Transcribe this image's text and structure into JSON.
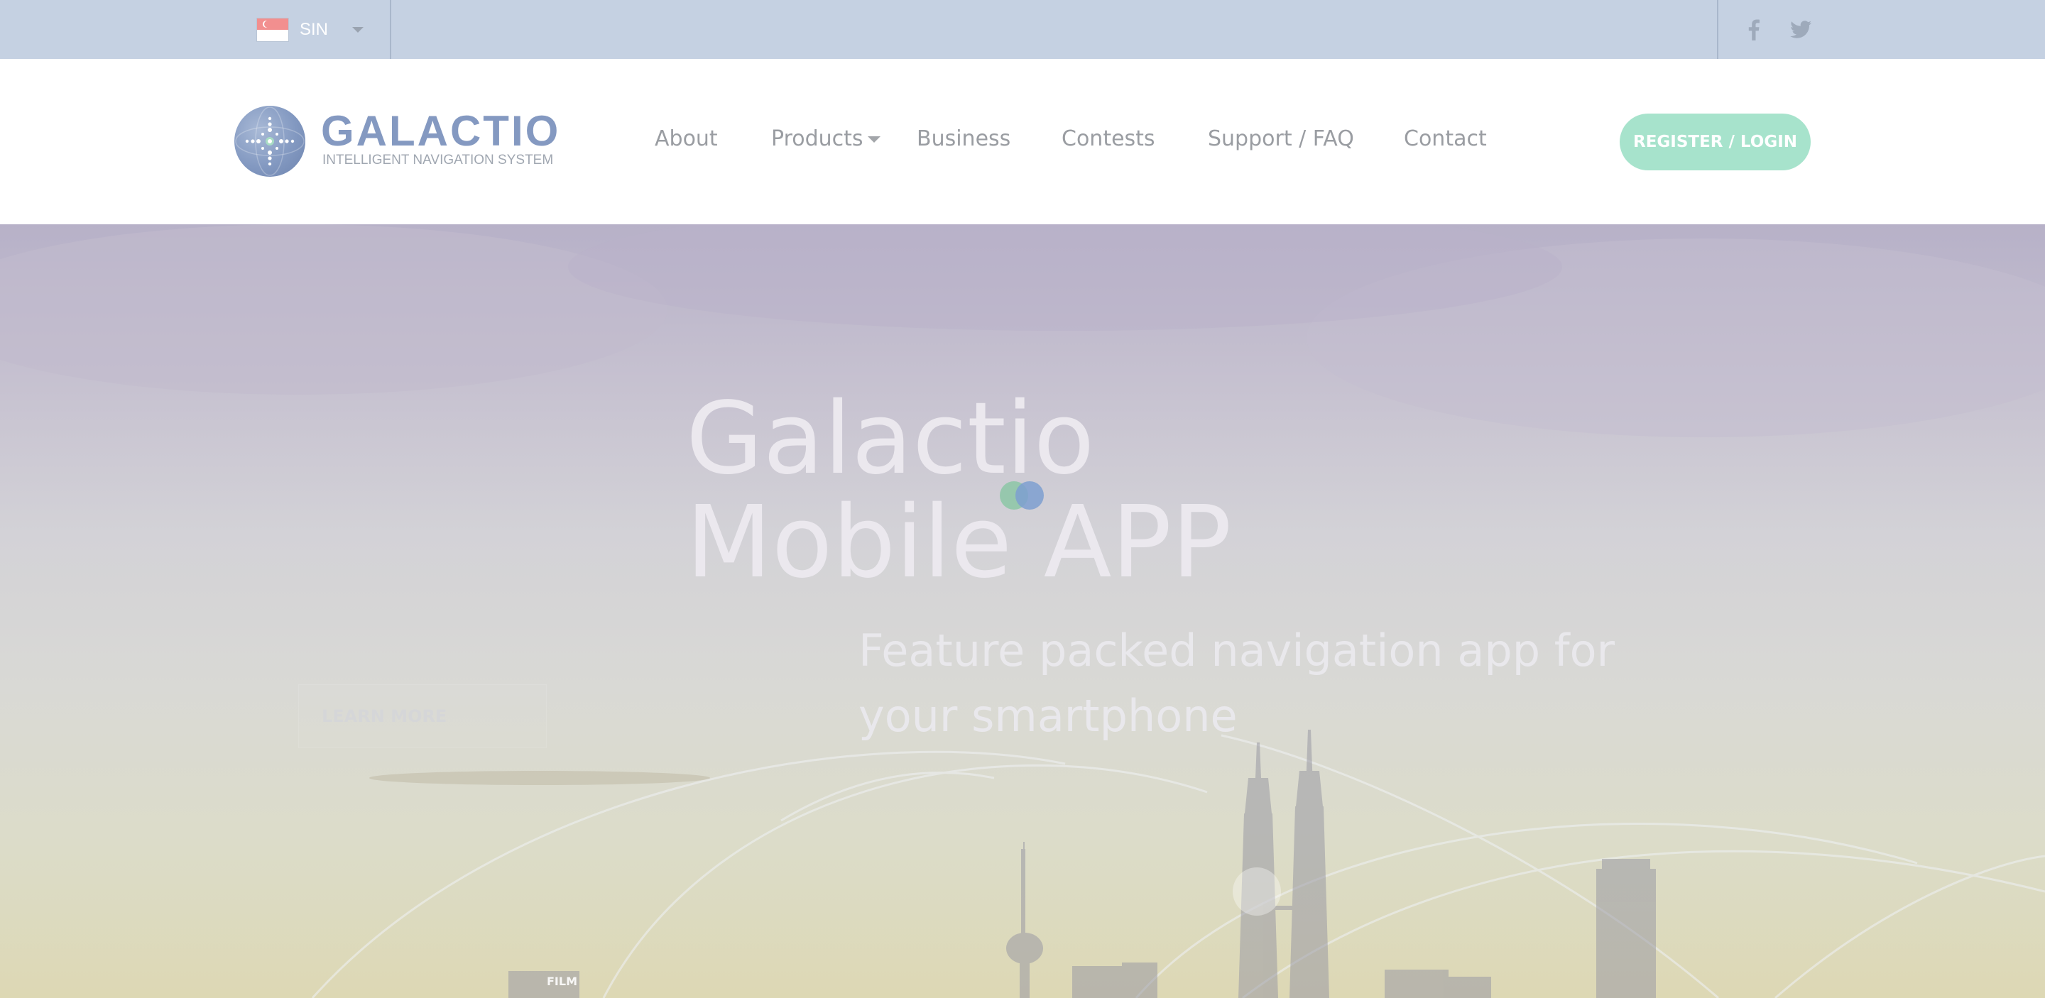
{
  "topbar": {
    "language": {
      "code": "SIN",
      "flag_icon": "singapore-flag-icon",
      "caret_icon": "caret-down-icon"
    },
    "social": [
      {
        "name": "facebook",
        "icon": "facebook-icon"
      },
      {
        "name": "twitter",
        "icon": "twitter-icon"
      }
    ]
  },
  "header": {
    "logo": {
      "wordmark": "GALACTIO",
      "tagline": "INTELLIGENT NAVIGATION SYSTEM",
      "icon": "globe-logo-icon"
    },
    "nav": {
      "about": "About",
      "products": "Products",
      "business": "Business",
      "contests": "Contests",
      "support": "Support / FAQ",
      "contact": "Contact"
    },
    "register_label": "REGISTER / LOGIN"
  },
  "hero": {
    "title_line1": "Galactio",
    "title_line2": "Mobile APP",
    "subtitle_line1": "Feature packed navigation app for",
    "subtitle_line2": "your smartphone",
    "cta_label": "LEARN MORE",
    "loader_icon": "loading-dots-icon",
    "sign_text": "FILM"
  },
  "colors": {
    "topbar_bg": "#c5d1e2",
    "header_bg": "#ffffff",
    "accent_green": "#a7e3cc",
    "logo_blue": "#8499c1",
    "nav_text": "#9a9da2",
    "loader_green": "#8fc7a8",
    "loader_blue": "#7e9fd0"
  }
}
